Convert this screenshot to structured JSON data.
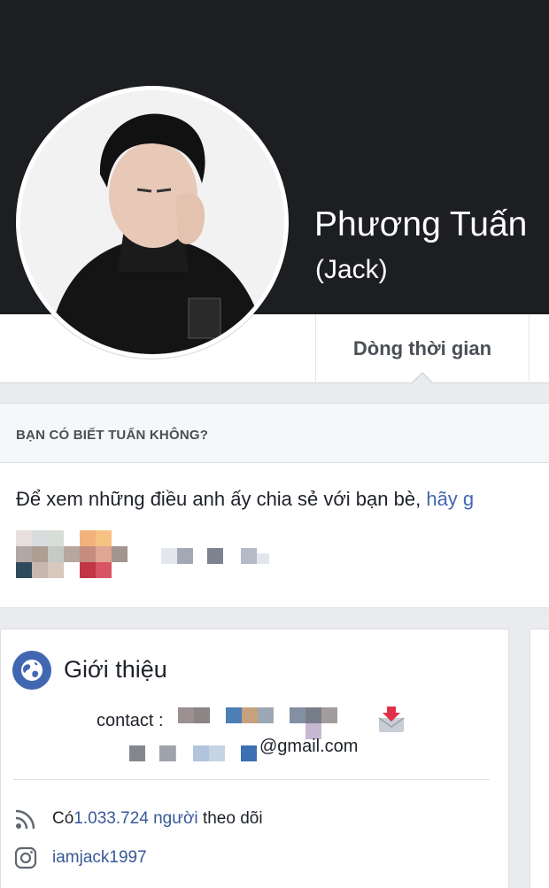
{
  "profile": {
    "name": "Phương Tuấn",
    "nickname": "(Jack)"
  },
  "nav": {
    "active_tab": "Dòng thời gian"
  },
  "know_card": {
    "header": "BẠN CÓ BIẾT TUẤN KHÔNG?",
    "body_text": "Để xem những điều anh ấy chia sẻ với bạn bè, ",
    "body_link": "hãy g"
  },
  "intro": {
    "title": "Giới thiệu",
    "contact_prefix": "contact :",
    "email_suffix": "@gmail.com",
    "followers_prefix": "Có ",
    "followers_count": "1.033.724",
    "followers_word": "người",
    "followers_suffix": "theo dõi",
    "instagram": "iamjack1997"
  },
  "icons": {
    "globe": "globe-icon",
    "mail": "mail-download-icon",
    "rss": "rss-icon",
    "instagram": "instagram-icon"
  },
  "colors": {
    "cover": "#1c1e21",
    "link": "#4267b2",
    "globe": "#4267b2"
  }
}
